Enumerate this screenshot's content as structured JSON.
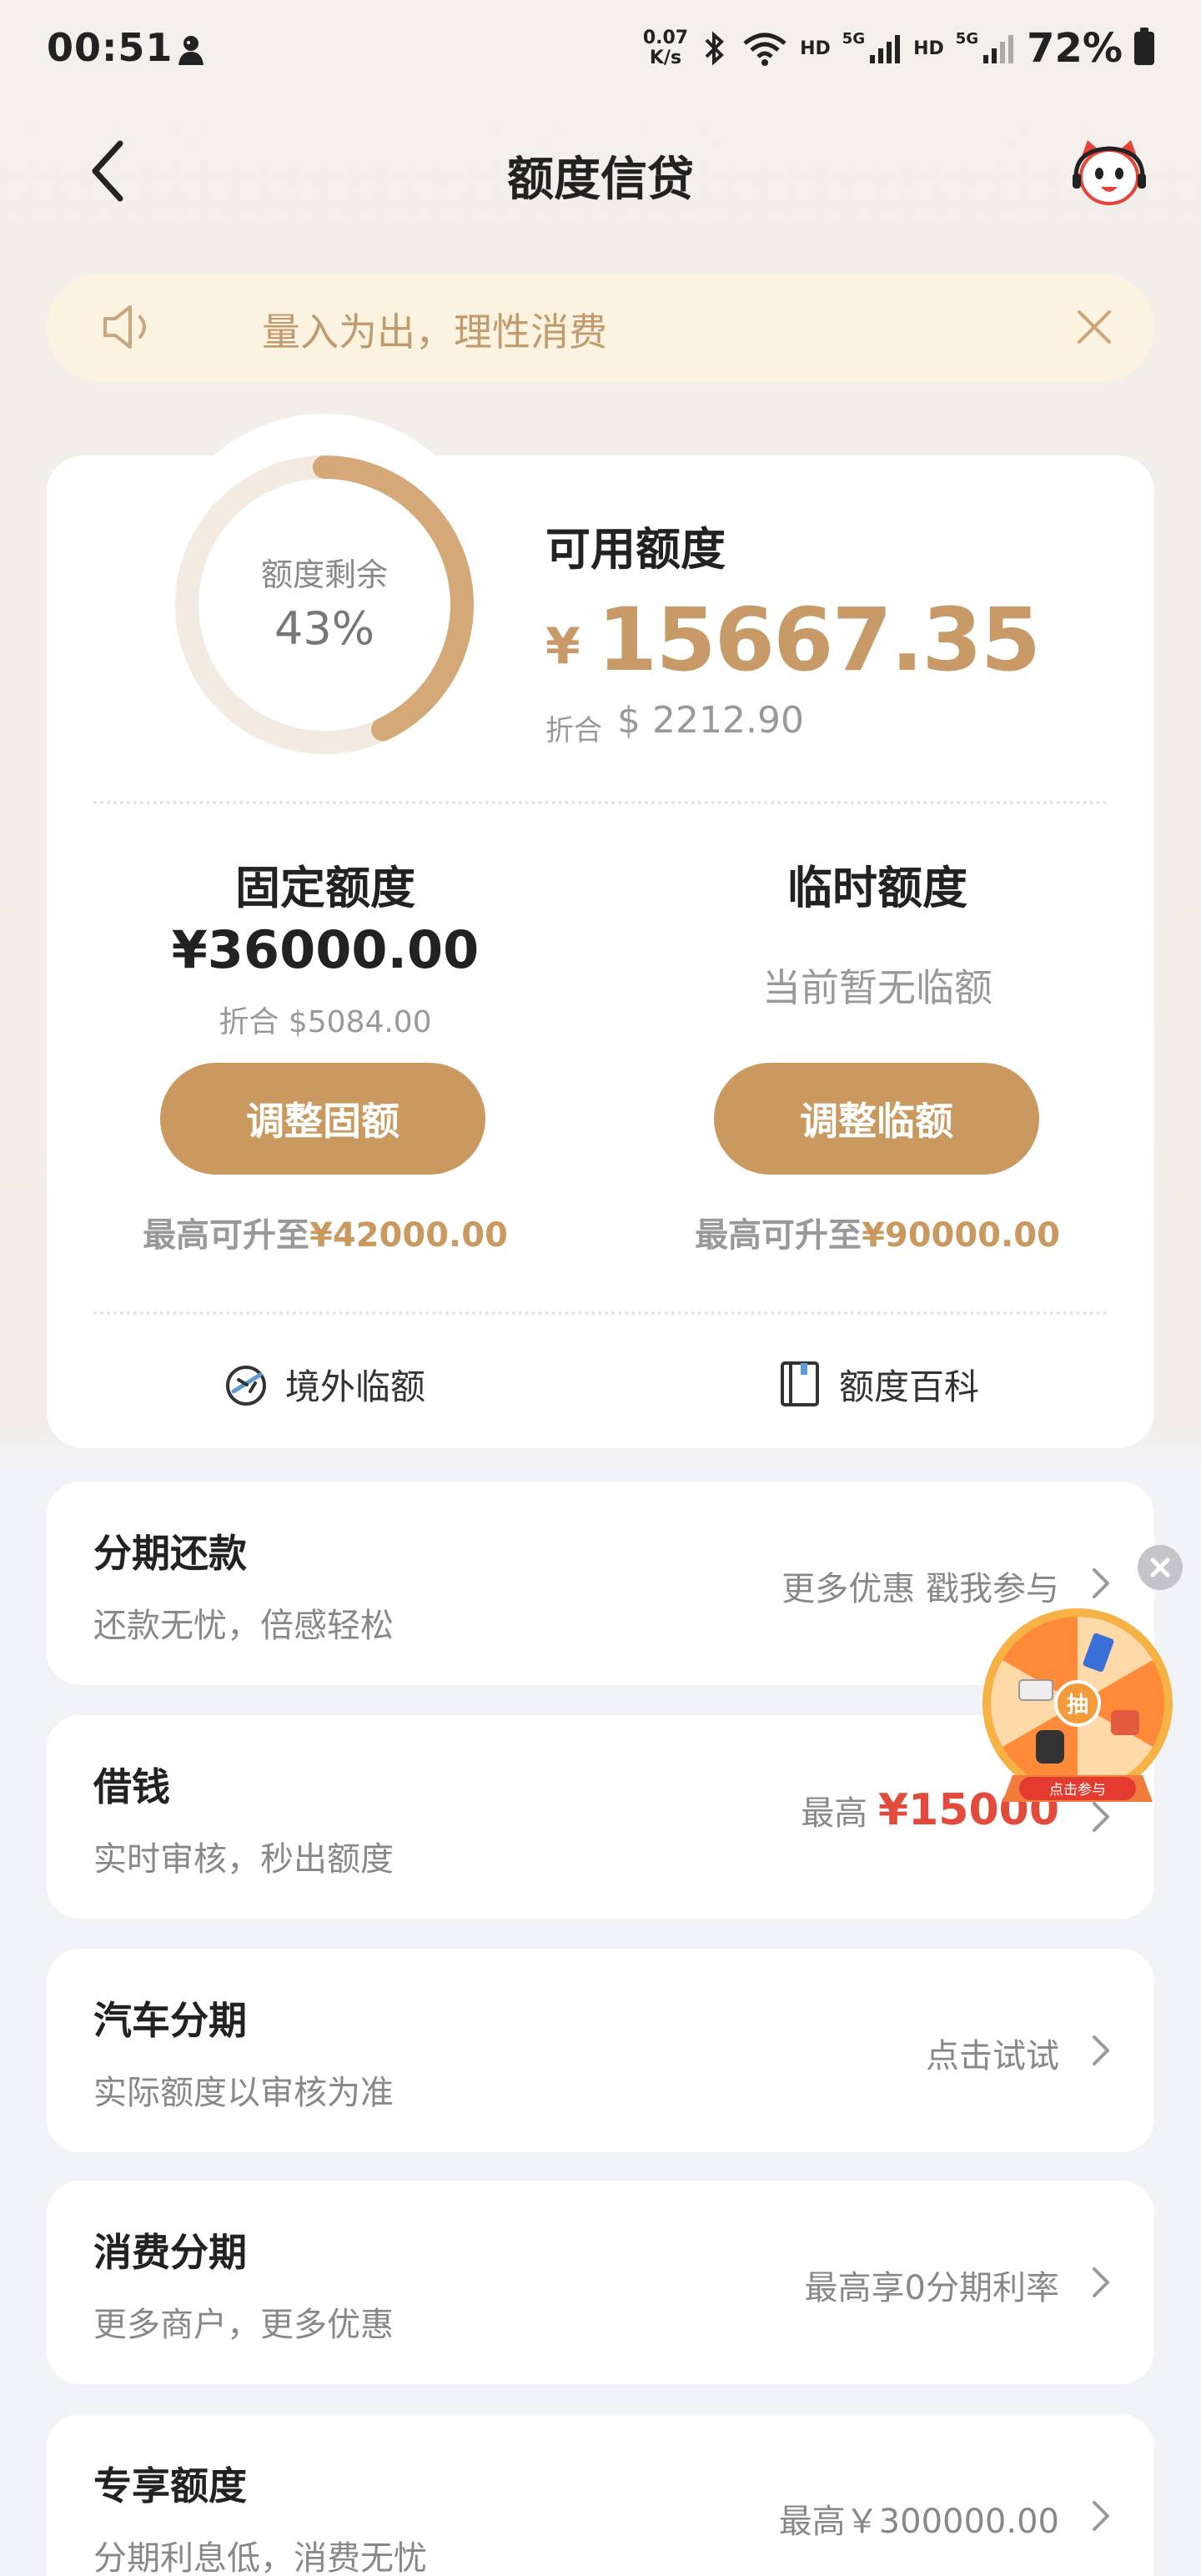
{
  "status_bar": {
    "time": "00:51",
    "speed_value": "0.07",
    "speed_unit": "K/s",
    "hd1": "HD",
    "net1": "5G",
    "hd2": "HD",
    "net2": "5G",
    "battery": "72%"
  },
  "header": {
    "title": "额度信贷",
    "back_icon": "chevron-left-icon",
    "service_icon": "customer-service-avatar-icon"
  },
  "notice": {
    "text": "量入为出，理性消费",
    "icon": "speaker-icon",
    "close_icon": "close-icon"
  },
  "credit": {
    "ring_label": "额度剩余",
    "ring_value": "43%",
    "ring_fraction": 0.43,
    "available_title": "可用额度",
    "currency_symbol": "¥",
    "available_amount": "15667.35",
    "converted_label": "折合",
    "converted_value": "$ 2212.90",
    "colors": {
      "accent": "#c9995f",
      "ring_track": "#f3ebe2",
      "ring_fill": "#d4a877"
    }
  },
  "fixed": {
    "title": "固定额度",
    "amount": "¥36000.00",
    "converted": "折合 $5084.00",
    "button": "调整固额",
    "max_prefix": "最高可升至",
    "max_value": "¥42000.00"
  },
  "temporary": {
    "title": "临时额度",
    "status": "当前暂无临额",
    "button": "调整临额",
    "max_prefix": "最高可升至",
    "max_value": "¥90000.00"
  },
  "links": {
    "overseas": "境外临额",
    "wiki": "额度百科"
  },
  "items": [
    {
      "title": "分期还款",
      "subtitle": "还款无忧，倍感轻松",
      "right": "更多优惠 戳我参与"
    },
    {
      "title": "借钱",
      "subtitle": "实时审核，秒出额度",
      "right_prefix": "最高",
      "right_highlight": "¥15000"
    },
    {
      "title": "汽车分期",
      "subtitle": "实际额度以审核为准",
      "right": "点击试试"
    },
    {
      "title": "消费分期",
      "subtitle": "更多商户，更多优惠",
      "right": "最高享0分期利率"
    },
    {
      "title": "专享额度",
      "subtitle": "分期利息低，消费无忧",
      "right": "最高￥300000.00"
    }
  ],
  "floating": {
    "wheel_center": "抽",
    "wheel_button": "点击参与"
  }
}
